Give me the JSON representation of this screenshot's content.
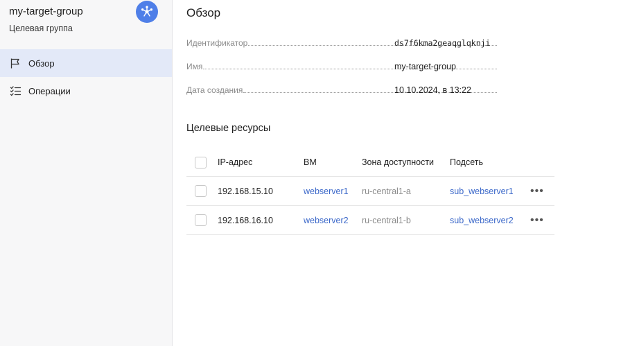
{
  "sidebar": {
    "title": "my-target-group",
    "subtitle": "Целевая группа",
    "service_icon": "network-load-balancer-icon",
    "items": [
      {
        "label": "Обзор",
        "icon": "flag-icon",
        "active": true
      },
      {
        "label": "Операции",
        "icon": "list-checks-icon",
        "active": false
      }
    ]
  },
  "main": {
    "title": "Обзор",
    "properties": [
      {
        "key": "Идентификатор",
        "value": "ds7f6kma2geaqglqknji"
      },
      {
        "key": "Имя",
        "value": "my-target-group"
      },
      {
        "key": "Дата создания",
        "value": "10.10.2024, в 13:22"
      }
    ],
    "resources_title": "Целевые ресурсы",
    "table": {
      "headers": [
        "IP-адрес",
        "ВМ",
        "Зона доступности",
        "Подсеть"
      ],
      "rows": [
        {
          "ip": "192.168.15.10",
          "vm": "webserver1",
          "zone": "ru-central1-a",
          "subnet": "sub_webserver1"
        },
        {
          "ip": "192.168.16.10",
          "vm": "webserver2",
          "zone": "ru-central1-b",
          "subnet": "sub_webserver2"
        }
      ],
      "more_label": "•••"
    }
  },
  "colors": {
    "accent": "#4f7fe8",
    "link": "#3a67c9",
    "active_nav": "#e3e9f8"
  }
}
